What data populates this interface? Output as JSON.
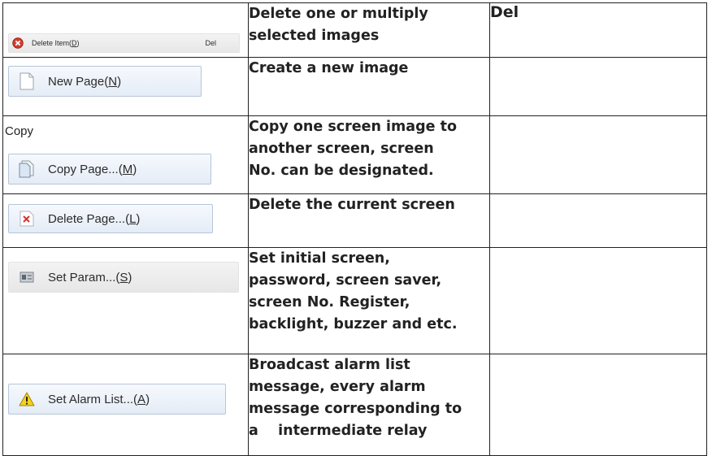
{
  "rows": [
    {
      "menu_label": "Delete Item",
      "menu_hotkey": "D",
      "menu_shortcut": "Del",
      "description": "Delete one or multiply\nselected images",
      "key": "Del"
    },
    {
      "menu_label": "New Page",
      "menu_hotkey": "N",
      "description": "Create a new image",
      "key": ""
    },
    {
      "caption": "Copy",
      "menu_label": "Copy Page...",
      "menu_hotkey": "M",
      "description": "Copy one screen image to\nanother screen, screen\nNo. can be designated.",
      "key": ""
    },
    {
      "menu_label": "Delete Page...",
      "menu_hotkey": "L",
      "description": "Delete the current screen",
      "key": ""
    },
    {
      "menu_label": "Set Param...",
      "menu_hotkey": "S",
      "description": "Set initial screen,\npassword, screen saver,\nscreen No. Register,\nbacklight, buzzer and etc.",
      "key": ""
    },
    {
      "menu_label": "Set Alarm List...",
      "menu_hotkey": "A",
      "description": "Broadcast alarm list\nmessage, every alarm\nmessage corresponding to\na    intermediate relay",
      "key": ""
    }
  ],
  "icons": {
    "row0": "delete-circle-icon",
    "row1": "new-page-icon",
    "row2": "copy-page-icon",
    "row3": "delete-page-icon",
    "row4": "set-param-icon",
    "row5": "warning-icon"
  }
}
